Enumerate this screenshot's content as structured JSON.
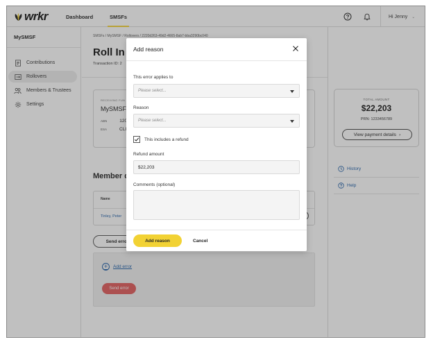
{
  "app": {
    "brand": "wrkr",
    "nav": [
      "Dashboard",
      "SMSFs"
    ],
    "user_greeting": "Hi Jenny",
    "accent_color": "#f2d234",
    "link_color": "#1f5fa8",
    "error_color": "#e25b5b"
  },
  "sidebar": {
    "title": "MySMSF",
    "items": [
      {
        "label": "Contributions",
        "icon": "document-icon"
      },
      {
        "label": "Rollovers",
        "icon": "rollover-icon",
        "active": true
      },
      {
        "label": "Members & Trustees",
        "icon": "people-icon"
      },
      {
        "label": "Settings",
        "icon": "gear-icon"
      }
    ]
  },
  "main": {
    "breadcrumb": "SMSFs / MySMSF / Rollovers / 2220d263-49d2-4665-8ab7-bba3290bc040",
    "title": "Roll In T",
    "transaction_label": "Transaction ID: 2",
    "fund_card": {
      "label": "RECEIVING FUN",
      "name": "MySMSF",
      "abn_key": "ABN",
      "abn_value": "120",
      "esa_key": "ESA",
      "esa_value": "CLI"
    },
    "members_heading": "Member d",
    "table": {
      "header": "Name",
      "row": "Tinley, Peter"
    },
    "send_error_button": "Send error",
    "add_error_link": "Add error",
    "send_error_red_button": "Send error"
  },
  "right_panel": {
    "total_label": "TOTAL AMOUNT",
    "total_value": "$22,203",
    "prn": "PRN: 1233456789",
    "view_payment_button": "View payment details",
    "history_link": "History",
    "help_link": "Help"
  },
  "modal": {
    "title": "Add reason",
    "applies_label": "This error applies to",
    "applies_placeholder": "Please select...",
    "reason_label": "Reason",
    "reason_placeholder": "Please select...",
    "refund_checkbox_label": "This includes a refund",
    "refund_checked": true,
    "refund_amount_label": "Refund amount",
    "refund_amount_value": "$22,203",
    "comments_label": "Comments (optional)",
    "comments_value": "",
    "primary_button": "Add reason",
    "cancel_button": "Cancel"
  }
}
